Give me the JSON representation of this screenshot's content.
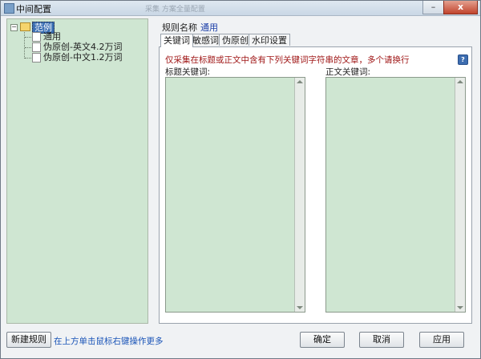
{
  "window": {
    "title": "中间配置",
    "faint_caption": "采集 方案全量配置",
    "close_label": "x",
    "minimize_label": "–"
  },
  "tree": {
    "root_label": "范例",
    "items": [
      "通用",
      "伪原创-英文4.2万词",
      "伪原创-中文1.2万词"
    ]
  },
  "rule": {
    "label": "规则名称",
    "value": "通用"
  },
  "tabs": [
    "关键词",
    "敏感词",
    "伪原创",
    "水印设置"
  ],
  "active_tab": "关键词",
  "keywords": {
    "hint": "仅采集在标题或正文中含有下列关键词字符串的文章，多个请换行",
    "title_label": "标题关键词:",
    "body_label": "正文关键词:",
    "title_value": "",
    "body_value": ""
  },
  "footer": {
    "new_rule_button": "新建规则",
    "hint": "在上方单击鼠标右键操作更多",
    "ok_button": "确定",
    "cancel_button": "取消",
    "apply_button": "应用"
  },
  "colors": {
    "field_bg": "#cfe6d2",
    "hint_red": "#a01818",
    "link_blue": "#1b55b8"
  }
}
